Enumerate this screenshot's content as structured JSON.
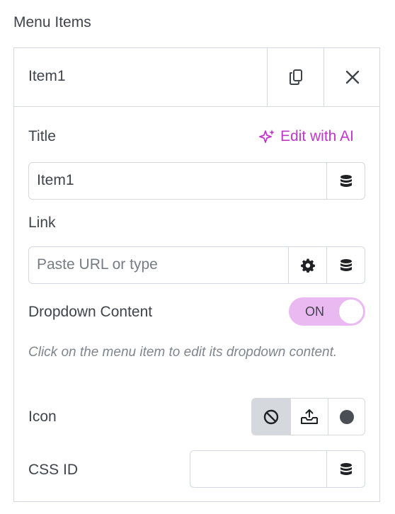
{
  "section": {
    "label": "Menu Items"
  },
  "item": {
    "title": "Item1",
    "duplicate_icon": "copy-icon",
    "remove_icon": "close-icon"
  },
  "fields": {
    "title": {
      "label": "Title",
      "ai_label": "Edit with AI",
      "ai_icon": "sparkle-icon",
      "value": "Item1",
      "dynamic_icon": "database-icon"
    },
    "link": {
      "label": "Link",
      "placeholder": "Paste URL or type",
      "settings_icon": "gear-icon",
      "dynamic_icon": "database-icon"
    },
    "dropdown": {
      "label": "Dropdown Content",
      "toggle_label": "ON",
      "toggle_state": true,
      "help_text": "Click on the menu item to edit its dropdown content."
    },
    "icon": {
      "label": "Icon",
      "options": [
        {
          "name": "none",
          "icon": "ban-icon",
          "selected": true
        },
        {
          "name": "upload",
          "icon": "upload-icon",
          "selected": false
        },
        {
          "name": "library",
          "icon": "circle-icon",
          "selected": false
        }
      ]
    },
    "css_id": {
      "label": "CSS ID",
      "value": "",
      "dynamic_icon": "database-icon"
    }
  },
  "colors": {
    "accent": "#c036c8",
    "toggle_bg": "#ebb9f2",
    "border": "#d5d8dc",
    "text": "#3f444b",
    "muted": "#7f858d"
  }
}
